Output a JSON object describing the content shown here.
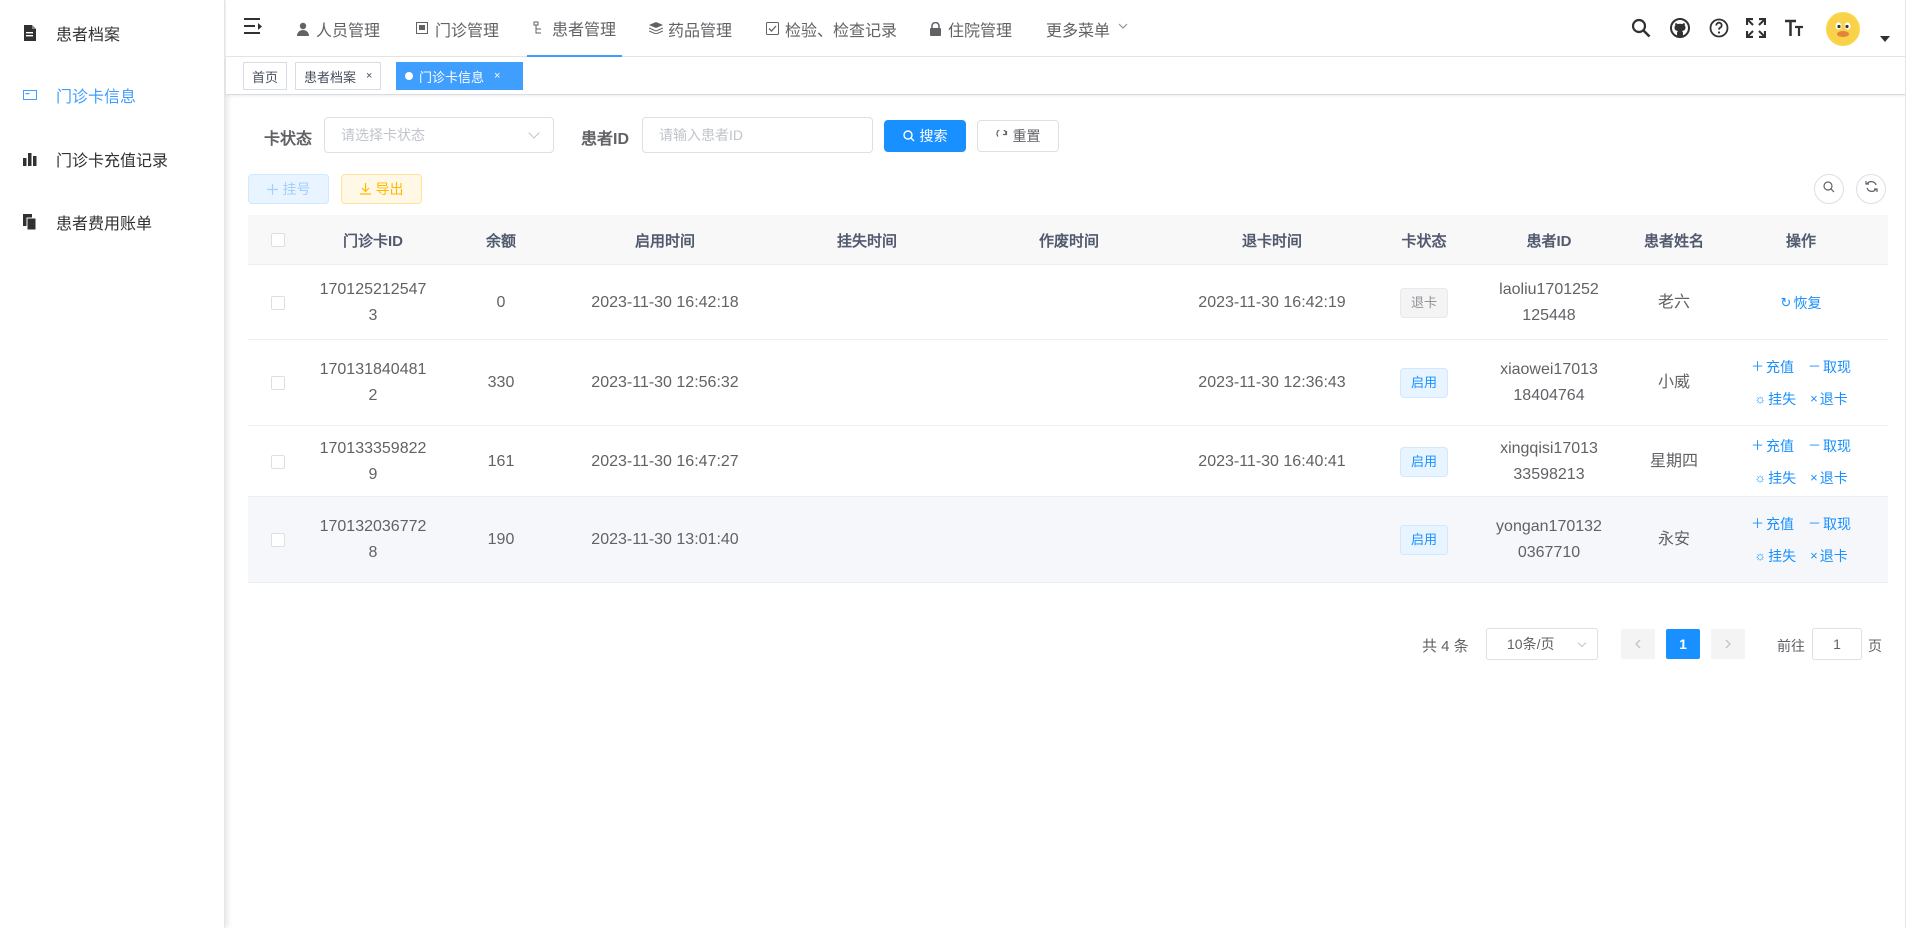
{
  "sidebar": {
    "items": [
      {
        "label": "患者档案",
        "icon": "document-icon"
      },
      {
        "label": "门诊卡信息",
        "icon": "card-icon",
        "active": true
      },
      {
        "label": "门诊卡充值记录",
        "icon": "bar-chart-icon"
      },
      {
        "label": "患者费用账单",
        "icon": "bill-icon"
      }
    ]
  },
  "topmenu": [
    {
      "label": "人员管理",
      "icon": "user-icon"
    },
    {
      "label": "门诊管理",
      "icon": "clinic-icon"
    },
    {
      "label": "患者管理",
      "icon": "tree-icon",
      "active": true
    },
    {
      "label": "药品管理",
      "icon": "layers-icon"
    },
    {
      "label": "检验、检查记录",
      "icon": "checkbox-icon"
    },
    {
      "label": "住院管理",
      "icon": "lock-icon"
    },
    {
      "label": "更多菜单",
      "icon": "chevron-down-icon"
    }
  ],
  "tags": [
    {
      "label": "首页"
    },
    {
      "label": "患者档案",
      "close": "×"
    },
    {
      "label": "门诊卡信息",
      "close": "×",
      "active": true
    }
  ],
  "search": {
    "status_label": "卡状态",
    "status_placeholder": "请选择卡状态",
    "patient_label": "患者ID",
    "patient_placeholder": "请输入患者ID",
    "search_btn": "搜索",
    "reset_btn": "重置"
  },
  "toolbar": {
    "register_btn": "挂号",
    "export_btn": "导出"
  },
  "table": {
    "headers": [
      "门诊卡ID",
      "余额",
      "启用时间",
      "挂失时间",
      "作废时间",
      "退卡时间",
      "卡状态",
      "患者ID",
      "患者姓名",
      "操作"
    ],
    "rows": [
      {
        "card_id_1": "170125212547",
        "card_id_2": "3",
        "balance": "0",
        "enable_time": "2023-11-30 16:42:18",
        "lost_time": "",
        "void_time": "",
        "refund_time": "2023-11-30 16:42:19",
        "status": "退卡",
        "patient_id_1": "laoliu1701252",
        "patient_id_2": "125448",
        "name": "老六",
        "ops": {
          "restore": "恢复"
        }
      },
      {
        "card_id_1": "170131840481",
        "card_id_2": "2",
        "balance": "330",
        "enable_time": "2023-11-30 12:56:32",
        "lost_time": "",
        "void_time": "",
        "refund_time": "2023-11-30 12:36:43",
        "status": "启用",
        "patient_id_1": "xiaowei17013",
        "patient_id_2": "18404764",
        "name": "小威",
        "ops": {
          "recharge": "充值",
          "withdraw": "取现",
          "lost": "挂失",
          "refund": "退卡"
        }
      },
      {
        "card_id_1": "170133359822",
        "card_id_2": "9",
        "balance": "161",
        "enable_time": "2023-11-30 16:47:27",
        "lost_time": "",
        "void_time": "",
        "refund_time": "2023-11-30 16:40:41",
        "status": "启用",
        "patient_id_1": "xingqisi17013",
        "patient_id_2": "33598213",
        "name": "星期四",
        "ops": {
          "recharge": "充值",
          "withdraw": "取现",
          "lost": "挂失",
          "refund": "退卡"
        }
      },
      {
        "card_id_1": "170132036772",
        "card_id_2": "8",
        "balance": "190",
        "enable_time": "2023-11-30 13:01:40",
        "lost_time": "",
        "void_time": "",
        "refund_time": "",
        "status": "启用",
        "patient_id_1": "yongan170132",
        "patient_id_2": "0367710",
        "name": "永安",
        "ops": {
          "recharge": "充值",
          "withdraw": "取现",
          "lost": "挂失",
          "refund": "退卡"
        }
      }
    ]
  },
  "pagination": {
    "total": "共 4 条",
    "page_size": "10条/页",
    "current": "1",
    "goto_label": "前往",
    "goto_value": "1",
    "page_suffix": "页"
  },
  "colors": {
    "primary": "#1890ff",
    "warning": "#ffba00",
    "menu_active": "#409eff"
  }
}
